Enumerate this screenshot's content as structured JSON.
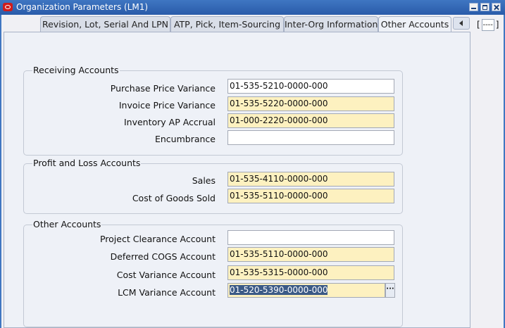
{
  "window": {
    "title": "Organization Parameters (LM1)"
  },
  "tabs": [
    {
      "label": "Revision, Lot, Serial And LPN",
      "active": false
    },
    {
      "label": "ATP, Pick, Item-Sourcing",
      "active": false
    },
    {
      "label": "Inter-Org Information",
      "active": false
    },
    {
      "label": "Other Accounts",
      "active": true
    }
  ],
  "tab_indicator": {
    "open": "[",
    "value": "----",
    "close": "]"
  },
  "groups": {
    "receiving": {
      "title": "Receiving Accounts",
      "fields": [
        {
          "label": "Purchase Price Variance",
          "value": "01-535-5210-0000-000"
        },
        {
          "label": "Invoice Price Variance",
          "value": "01-535-5220-0000-000"
        },
        {
          "label": "Inventory AP Accrual",
          "value": "01-000-2220-0000-000"
        },
        {
          "label": "Encumbrance",
          "value": ""
        }
      ]
    },
    "profit_loss": {
      "title": "Profit and Loss Accounts",
      "fields": [
        {
          "label": "Sales",
          "value": "01-535-4110-0000-000"
        },
        {
          "label": "Cost of Goods Sold",
          "value": "01-535-5110-0000-000"
        }
      ]
    },
    "other": {
      "title": "Other Accounts",
      "fields": [
        {
          "label": "Project Clearance Account",
          "value": ""
        },
        {
          "label": "Deferred COGS Account",
          "value": "01-535-5110-0000-000"
        },
        {
          "label": "Cost Variance Account",
          "value": "01-535-5315-0000-000"
        },
        {
          "label": "LCM Variance Account",
          "value": "01-520-5390-0000-000"
        }
      ]
    }
  },
  "lov_button_label": "···",
  "colors": {
    "titlebar": "#2f64b3",
    "required_field": "#fdf1c0",
    "selection": "#3b5a86"
  }
}
